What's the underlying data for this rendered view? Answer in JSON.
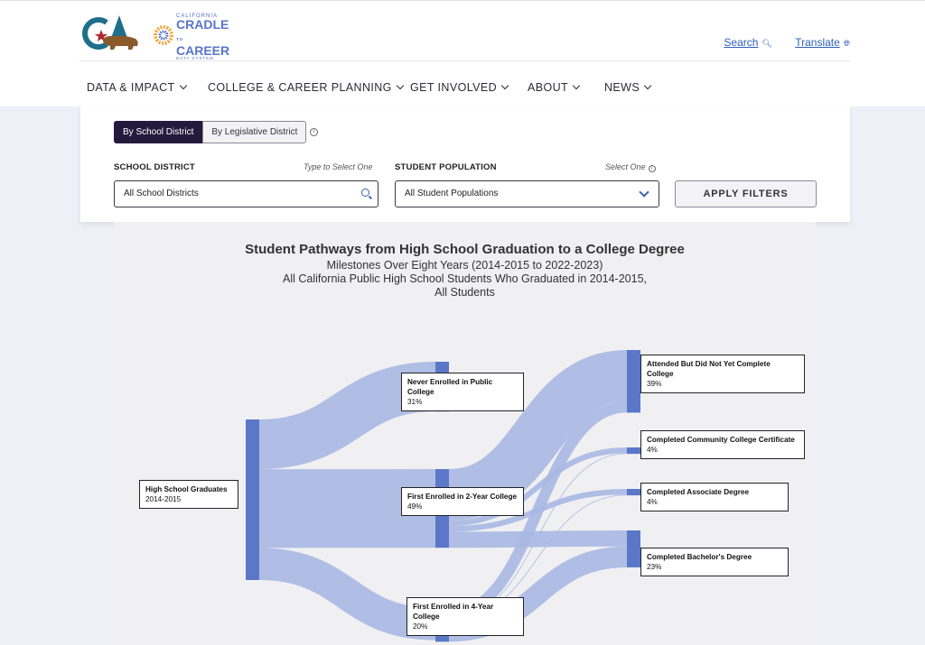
{
  "header": {
    "brand_small": "CALIFORNIA",
    "brand_line1": "CRADLE",
    "brand_to": "TO",
    "brand_line2": "CAREER",
    "brand_tiny": "DATA SYSTEM",
    "search_label": "Search",
    "translate_label": "Translate"
  },
  "nav": {
    "items": [
      {
        "label": "DATA & IMPACT"
      },
      {
        "label": "COLLEGE & CAREER PLANNING"
      },
      {
        "label": "GET INVOLVED"
      },
      {
        "label": "ABOUT"
      },
      {
        "label": "NEWS"
      }
    ]
  },
  "filters": {
    "toggle_active": "By School District",
    "toggle_inactive": "By Legislative District",
    "district_label": "SCHOOL DISTRICT",
    "district_hint": "Type to Select One",
    "district_value": "All School Districts",
    "population_label": "STUDENT POPULATION",
    "population_hint": "Select One",
    "population_value": "All Student Populations",
    "apply_label": "APPLY FILTERS"
  },
  "colors": {
    "node": "#5b78c8",
    "flow": "#a8b8e3",
    "toggle_active_bg": "#241a3e",
    "link": "#2f5fb8"
  },
  "chart_data": {
    "type": "sankey",
    "title": "Student Pathways from High School Graduation to a College Degree",
    "subtitle_lines": [
      "Milestones Over Eight Years (2014-2015 to 2022-2023)",
      "All California Public High School Students Who Graduated in 2014-2015,",
      "All Students"
    ],
    "nodes": [
      {
        "id": "hs",
        "name": "High School Graduates",
        "sub": "2014-2015"
      },
      {
        "id": "never",
        "name": "Never Enrolled in Public College",
        "sub": "31%"
      },
      {
        "id": "two",
        "name": "First Enrolled in 2-Year College",
        "sub": "49%"
      },
      {
        "id": "four",
        "name": "First Enrolled in 4-Year College",
        "sub": "20%"
      },
      {
        "id": "attended",
        "name": "Attended But Did Not Yet Complete College",
        "sub": "39%"
      },
      {
        "id": "cert",
        "name": "Completed Community College Certificate",
        "sub": "4%"
      },
      {
        "id": "assoc",
        "name": "Completed Associate Degree",
        "sub": "4%"
      },
      {
        "id": "bach",
        "name": "Completed Bachelor's Degree",
        "sub": "23%"
      }
    ],
    "links": [
      {
        "source": "hs",
        "target": "never",
        "value": 31
      },
      {
        "source": "hs",
        "target": "two",
        "value": 49
      },
      {
        "source": "hs",
        "target": "four",
        "value": 20
      },
      {
        "source": "two",
        "target": "attended",
        "value": 32
      },
      {
        "source": "two",
        "target": "cert",
        "value": 3.5
      },
      {
        "source": "two",
        "target": "assoc",
        "value": 3.5
      },
      {
        "source": "two",
        "target": "bach",
        "value": 10
      },
      {
        "source": "four",
        "target": "attended",
        "value": 7
      },
      {
        "source": "four",
        "target": "cert",
        "value": 0.5
      },
      {
        "source": "four",
        "target": "assoc",
        "value": 0.5
      },
      {
        "source": "four",
        "target": "bach",
        "value": 13
      }
    ]
  }
}
